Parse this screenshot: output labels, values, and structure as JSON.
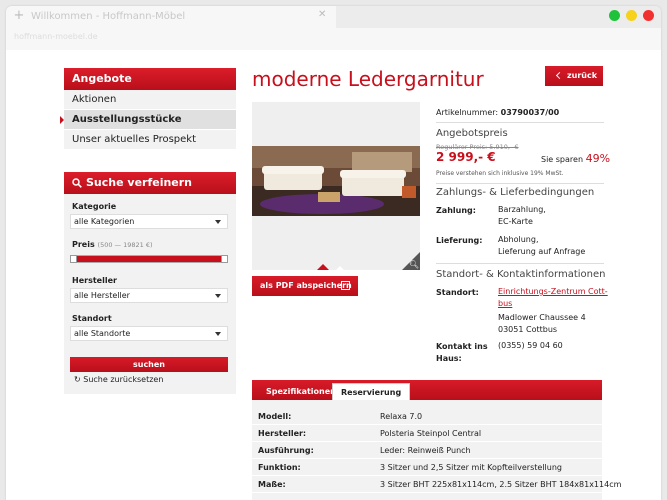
{
  "browser": {
    "tab_title": "Willkommen - Hoffmann-Möbel",
    "address": "hoffmann-moebel.de",
    "plus_glyph": "+",
    "close_glyph": "✕",
    "dot_colors": [
      "#21c23b",
      "#f6d21a",
      "#f0312f"
    ]
  },
  "sidebar": {
    "offers_title": "Angebote",
    "items": [
      {
        "label": "Aktionen"
      },
      {
        "label": "Ausstellungsstücke"
      },
      {
        "label": "Unser aktuelles Prospekt"
      }
    ],
    "filter_title": "Suche verfeinern",
    "category_label": "Kategorie",
    "category_value": "alle Kategorien",
    "price_label": "Preis",
    "price_hint": "(500 — 19821 €)",
    "price_range": {
      "min": 500,
      "max": 19821,
      "low_fraction": 0.0,
      "high_fraction": 1.0
    },
    "manufacturer_label": "Hersteller",
    "manufacturer_value": "alle Hersteller",
    "location_label": "Standort",
    "location_value": "alle Standorte",
    "search_button": "suchen",
    "reset_link": "Suche zurücksetzen"
  },
  "product": {
    "title": "moderne Ledergarnitur",
    "back_button": "zurück",
    "pdf_button": "als PDF abspeichern",
    "article_label": "Artikelnummer:",
    "article_number": "03790037/00",
    "offer_title": "Angebotspreis",
    "regular_price": "Regulärer Preis: 5.910,- €",
    "price": "2 999,- €",
    "savings_label": "Sie sparen",
    "savings_value": "49%",
    "vat_note": "Preise verstehen sich inklusive 19% MwSt.",
    "payment_title": "Zahlungs- & Lieferbedingungen",
    "payment_label": "Zahlung:",
    "payment_1": "Barzahlung,",
    "payment_2": "EC-Karte",
    "delivery_label": "Lieferung:",
    "delivery_1": "Abholung,",
    "delivery_2": "Lieferung auf Anfrage",
    "location_title": "Standort- & Kontaktinformationen",
    "location_label": "Standort:",
    "location_link_1": "Einrichtungs-Zentrum Cott-",
    "location_link_2": "bus",
    "street": "Madlower Chaussee 4",
    "city": "03051 Cottbus",
    "contact_label_1": "Kontakt ins",
    "contact_label_2": "Haus:",
    "phone": "(0355) 59 04 60"
  },
  "specs": {
    "tab_specs": "Spezifikationen",
    "tab_reservation": "Reservierung",
    "rows": [
      {
        "key": "Modell:",
        "value": "Relaxa 7.0"
      },
      {
        "key": "Hersteller:",
        "value": "Polsteria Steinpol Central"
      },
      {
        "key": "Ausführung:",
        "value": "Leder: Reinweiß Punch"
      },
      {
        "key": "Funktion:",
        "value": "3 Sitzer und 2,5 Sitzer mit Kopfteilverstellung"
      },
      {
        "key": "Maße:",
        "value": "3 Sitzer BHT 225x81x114cm, 2.5 Sitzer BHT 184x81x114cm"
      }
    ]
  },
  "colors": {
    "accent": "#c8101d"
  }
}
